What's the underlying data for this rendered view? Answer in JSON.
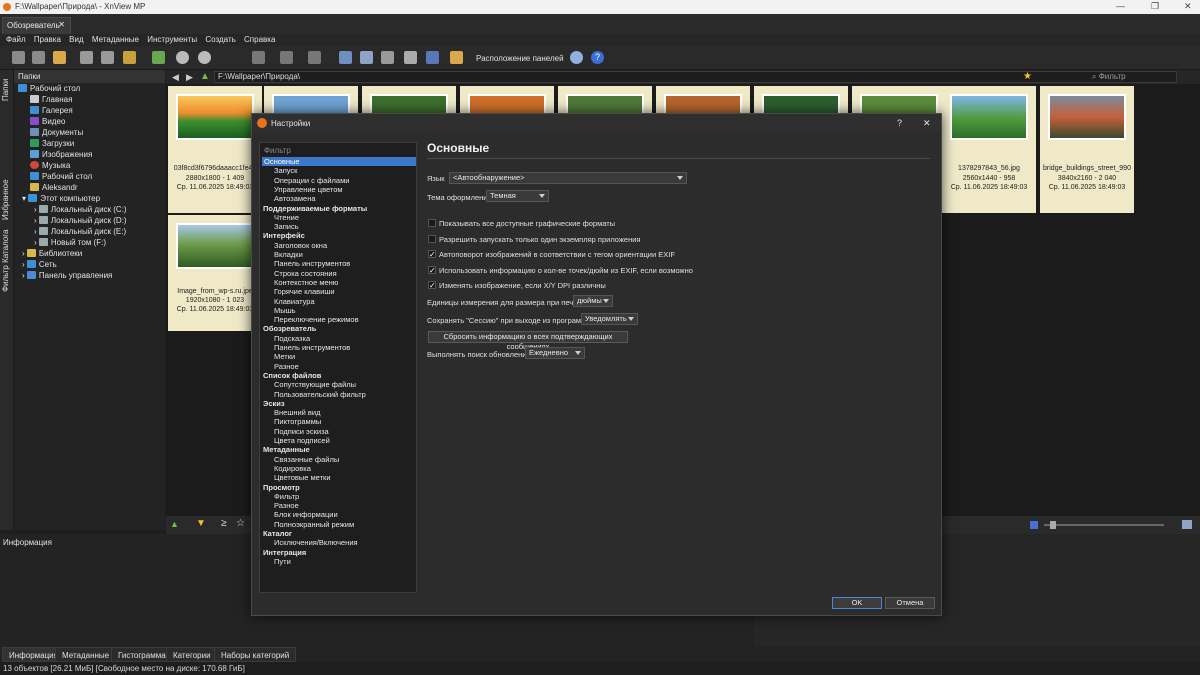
{
  "window": {
    "title": "F:\\Wallpaper\\Природа\\ - XnView MP",
    "minimize": "—",
    "maximize": "❐",
    "close": "✕"
  },
  "tab": {
    "label": "Обозреватель",
    "close": "✕"
  },
  "menu": [
    "Файл",
    "Правка",
    "Вид",
    "Метаданные",
    "Инструменты",
    "Создать",
    "Справка"
  ],
  "toolbar": {
    "panels_label": "Расположение панелей",
    "help_icon": "?"
  },
  "side_tabs": [
    "Папки",
    "Избранное",
    "Фильтр Каталога"
  ],
  "folders": {
    "header": "Папки",
    "items": [
      "Рабочий стол",
      "Главная",
      "Галерея",
      "Видео",
      "Документы",
      "Загрузки",
      "Изображения",
      "Музыка",
      "Рабочий стол",
      "Aleksandr",
      "Этот компьютер",
      "Локальный диск (C:)",
      "Локальный диск (D:)",
      "Локальный диск (E:)",
      "Новый том (F:)",
      "Библиотеки",
      "Сеть",
      "Панель управления"
    ]
  },
  "path": {
    "value": "F:\\Wallpaper\\Природа\\",
    "filter_placeholder": "Фильтр"
  },
  "thumbs": [
    {
      "name": "03f8cd3f6796daaacc1fe43",
      "dims": "2880x1800 - 1 409",
      "date": "Ср. 11.06.2025 18:49:03"
    },
    {
      "name": "1378297843_56.jpg",
      "dims": "2560x1440 - 958",
      "date": "Ср. 11.06.2025 18:49:03"
    },
    {
      "name": "bridge_buildings_street_990",
      "dims": "3840x2160 - 2 040",
      "date": "Ср. 11.06.2025 18:49:03"
    },
    {
      "name": "Image_from_wp-s.ru.jpe",
      "dims": "1920x1080 - 1 023",
      "date": "Ср. 11.06.2025 18:49:03"
    }
  ],
  "info_panel": {
    "title": "Информация"
  },
  "bottom_tabs": [
    "Информация",
    "Метаданные",
    "Гистограмма",
    "Категории",
    "Наборы категорий"
  ],
  "status": "13 объектов [26.21 МиБ] [Свободное место на диске: 170.68 ГиБ]",
  "dialog": {
    "title": "Настройки",
    "help": "?",
    "close": "✕",
    "filter_placeholder": "Фильтр",
    "nav": [
      {
        "label": "Основные",
        "level": "sub",
        "selected": true
      },
      {
        "label": "Запуск",
        "level": "sub2"
      },
      {
        "label": "Операции с файлами",
        "level": "sub2"
      },
      {
        "label": "Управление цветом",
        "level": "sub2"
      },
      {
        "label": "Автозамена",
        "level": "sub2"
      },
      {
        "label": "Поддерживаемые форматы",
        "level": "group"
      },
      {
        "label": "Чтение",
        "level": "sub2"
      },
      {
        "label": "Запись",
        "level": "sub2"
      },
      {
        "label": "Интерфейс",
        "level": "group"
      },
      {
        "label": "Заголовок окна",
        "level": "sub2"
      },
      {
        "label": "Вкладки",
        "level": "sub2"
      },
      {
        "label": "Панель инструментов",
        "level": "sub2"
      },
      {
        "label": "Строка состояния",
        "level": "sub2"
      },
      {
        "label": "Контекстное меню",
        "level": "sub2"
      },
      {
        "label": "Горячие клавиши",
        "level": "sub2"
      },
      {
        "label": "Клавиатура",
        "level": "sub2"
      },
      {
        "label": "Мышь",
        "level": "sub2"
      },
      {
        "label": "Переключение режимов",
        "level": "sub2"
      },
      {
        "label": "Обозреватель",
        "level": "group"
      },
      {
        "label": "Подсказка",
        "level": "sub2"
      },
      {
        "label": "Панель инструментов",
        "level": "sub2"
      },
      {
        "label": "Метки",
        "level": "sub2"
      },
      {
        "label": "Разное",
        "level": "sub2"
      },
      {
        "label": "Список файлов",
        "level": "group"
      },
      {
        "label": "Сопутствующие файлы",
        "level": "sub2"
      },
      {
        "label": "Пользовательский фильтр",
        "level": "sub2"
      },
      {
        "label": "Эскиз",
        "level": "group"
      },
      {
        "label": "Внешний вид",
        "level": "sub2"
      },
      {
        "label": "Пиктограммы",
        "level": "sub2"
      },
      {
        "label": "Подписи эскиза",
        "level": "sub2"
      },
      {
        "label": "Цвета подписей",
        "level": "sub2"
      },
      {
        "label": "Метаданные",
        "level": "group"
      },
      {
        "label": "Связанные файлы",
        "level": "sub2"
      },
      {
        "label": "Кодировка",
        "level": "sub2"
      },
      {
        "label": "Цветовые метки",
        "level": "sub2"
      },
      {
        "label": "Просмотр",
        "level": "group"
      },
      {
        "label": "Фильтр",
        "level": "sub2"
      },
      {
        "label": "Разное",
        "level": "sub2"
      },
      {
        "label": "Блок информации",
        "level": "sub2"
      },
      {
        "label": "Полноэкранный режим",
        "level": "sub2"
      },
      {
        "label": "Каталог",
        "level": "group"
      },
      {
        "label": "Исключения/Включения",
        "level": "sub2"
      },
      {
        "label": "Интеграция",
        "level": "group"
      },
      {
        "label": "Пути",
        "level": "sub2"
      }
    ],
    "heading": "Основные",
    "language_label": "Язык",
    "language_value": "<Автообнаружение>",
    "theme_label": "Тема оформления",
    "theme_value": "Темная",
    "checks": [
      {
        "label": "Показывать все доступные графические форматы",
        "checked": false
      },
      {
        "label": "Разрешить запускать только один экземпляр приложения",
        "checked": false
      },
      {
        "label": "Автоповорот изображений в соответствии с тегом ориентации EXIF",
        "checked": true
      },
      {
        "label": "Использовать информацию о кол-ве точек/дюйм из EXIF, если возможно",
        "checked": true
      },
      {
        "label": "Изменять изображение, если X/Y DPI различны",
        "checked": true
      }
    ],
    "units_label": "Единицы измерения для размера при печати",
    "units_value": "дюймы",
    "session_label": "Сохранять \"Сессию\" при выходе из программы",
    "session_value": "Уведомлять",
    "reset_button": "Сбросить информацию о всех подтверждающих сообщениях",
    "update_label": "Выполнять поиск обновлений",
    "update_value": "Ежедневно",
    "ok": "OK",
    "cancel": "Отмена"
  }
}
